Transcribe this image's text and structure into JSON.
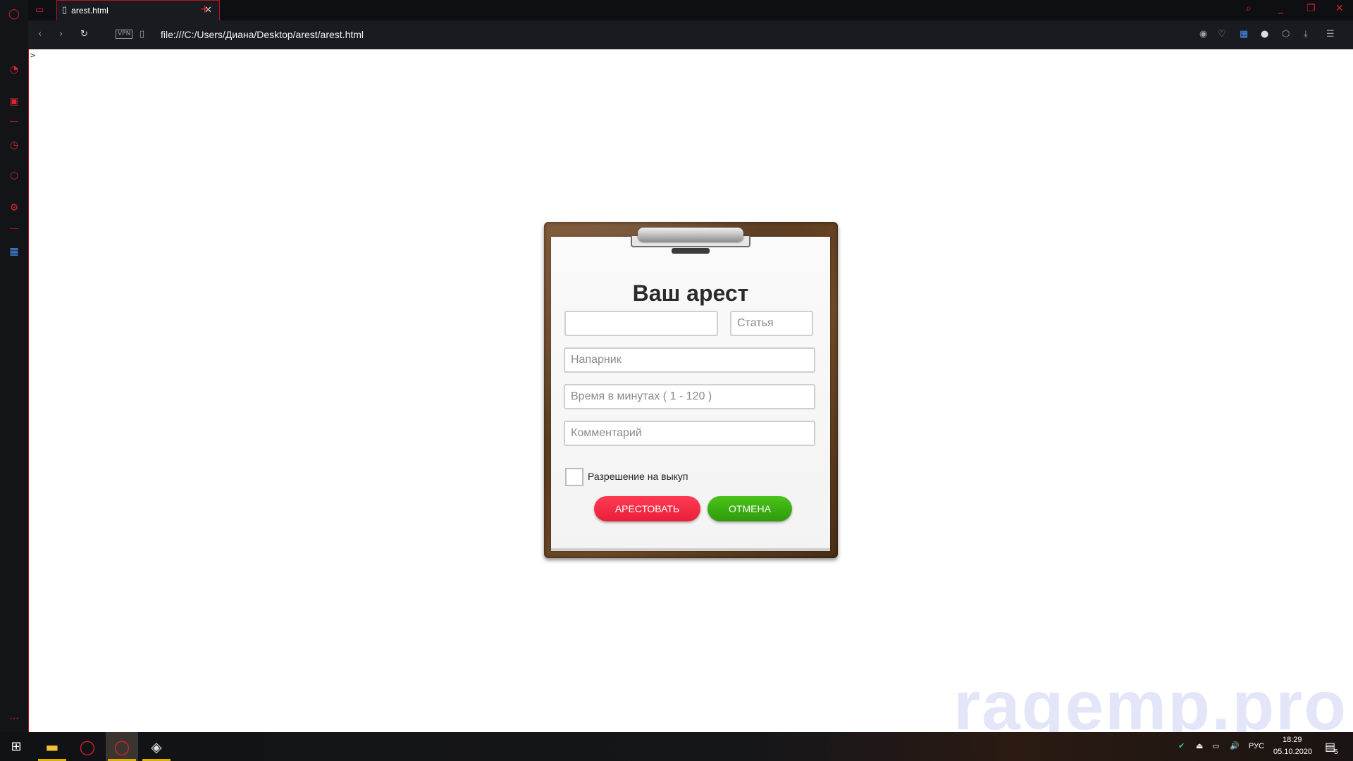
{
  "browser": {
    "tab_title": "arest.html",
    "url": "file:///C:/Users/Диана/Desktop/arest/arest.html",
    "vpn_label": "VPN",
    "tab_close": "✕",
    "new_tab": "+"
  },
  "page": {
    "caret": ">"
  },
  "form": {
    "title": "Ваш арест",
    "fields": {
      "name_placeholder": "",
      "article_placeholder": "Статья",
      "partner_placeholder": "Напарник",
      "time_placeholder": "Время в минутах ( 1 - 120 )",
      "comment_placeholder": "Комментарий"
    },
    "checkbox_label": "Разрешение на выкуп",
    "buttons": {
      "arrest": "АРЕСТОВАТЬ",
      "cancel": "ОТМЕНА"
    }
  },
  "watermark": "ragemp.pro",
  "taskbar": {
    "lang": "РУС",
    "time": "18:29",
    "date": "05.10.2020",
    "notifications": "5"
  },
  "colors": {
    "accent_red": "#d8242c",
    "arrest_button": "#f0263f",
    "cancel_button": "#3aa813",
    "clipboard_wood": "#5a3a1e"
  }
}
